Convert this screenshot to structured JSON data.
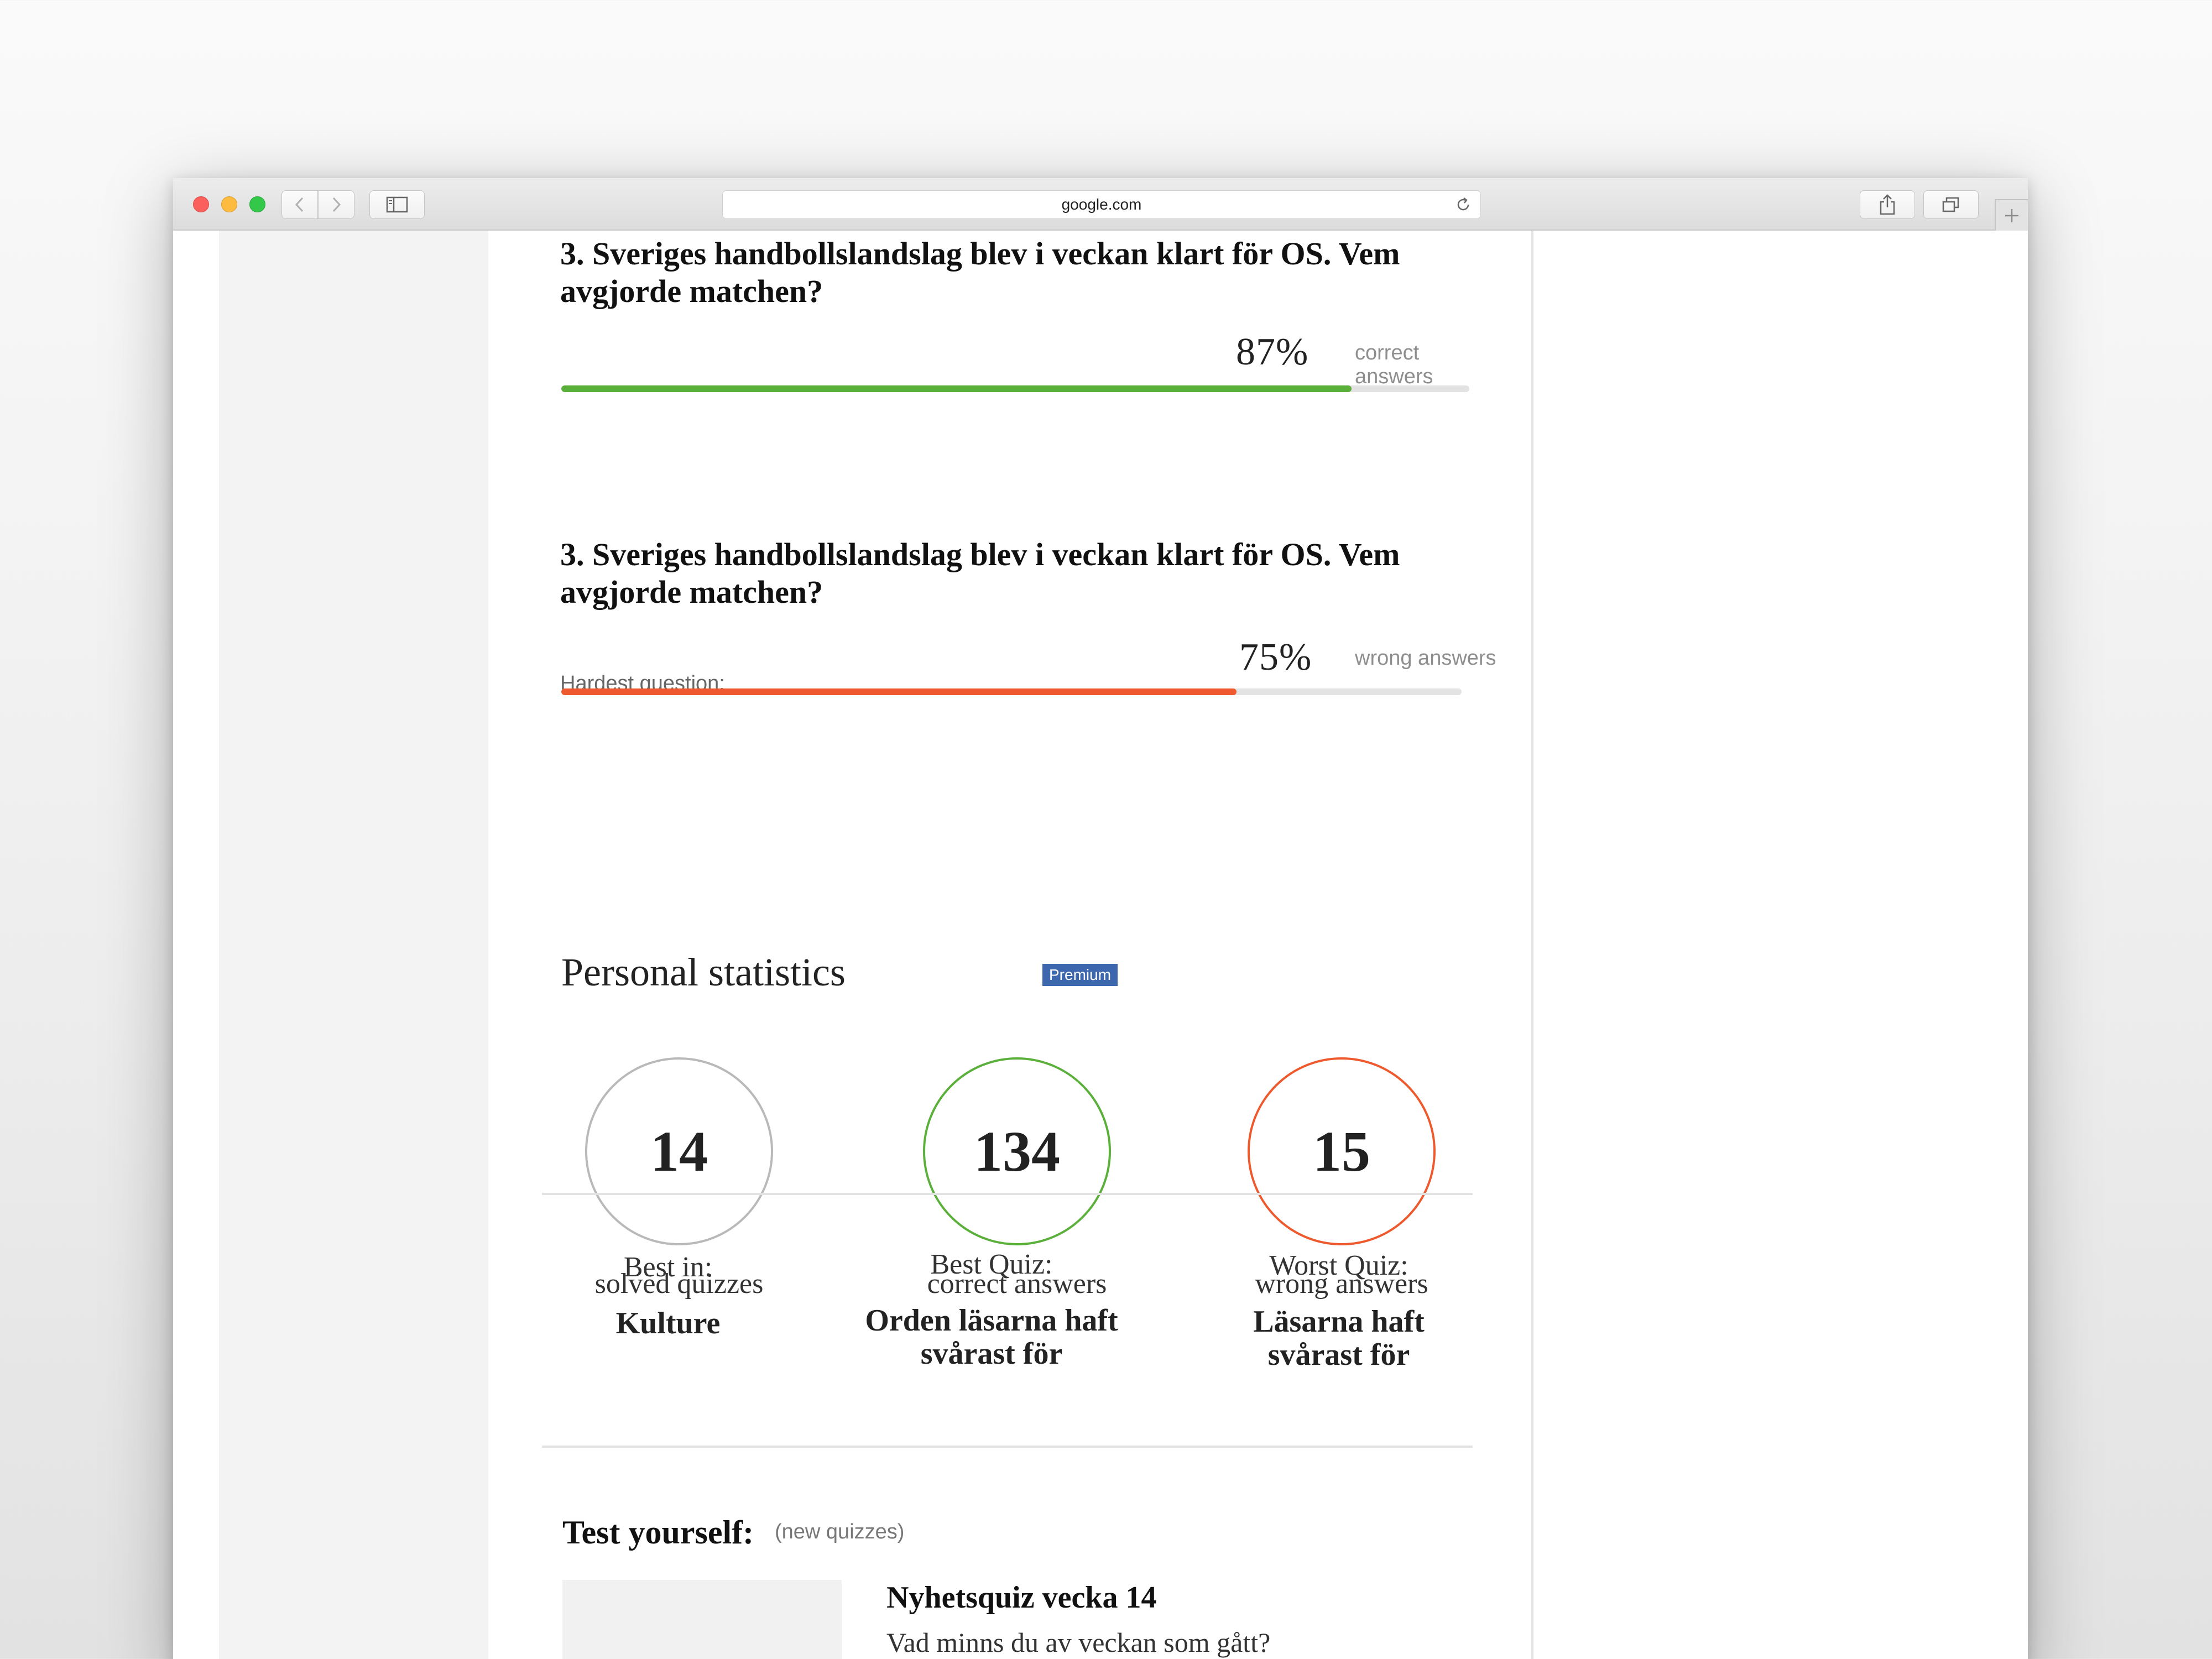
{
  "browser": {
    "url": "google.com"
  },
  "quiz_stats": {
    "easiest": {
      "question": "3. Sveriges handbollslandslag blev i veckan klart för OS. Vem avgjorde matchen?",
      "percent_text": "87%",
      "percent_value": 87,
      "label": "correct answers",
      "color": "#5bb03b"
    },
    "hardest": {
      "heading": "Hardest question:",
      "question": "3. Sveriges handbollslandslag blev i veckan klart för OS. Vem avgjorde matchen?",
      "percent_text": "75%",
      "percent_value": 75,
      "label": "wrong answers",
      "color": "#ee5a2e"
    }
  },
  "personal": {
    "title": "Personal statistics",
    "badge": "Premium",
    "stats": [
      {
        "value": "14",
        "label": "solved quizzes",
        "color": "#b9b9b9"
      },
      {
        "value": "134",
        "label": "correct answers",
        "color": "#5bb03b"
      },
      {
        "value": "15",
        "label": "wrong answers",
        "color": "#ee5a2e"
      }
    ],
    "best": [
      {
        "label": "Best in:",
        "value": "Kulture"
      },
      {
        "label": "Best Quiz:",
        "value": "Orden läsarna haft svårast för"
      },
      {
        "label": "Worst Quiz:",
        "value": "Läsarna haft svårast för"
      }
    ]
  },
  "test_yourself": {
    "title": "Test yourself:",
    "subtitle": "(new quizzes)",
    "card": {
      "title": "Nyhetsquiz vecka 14",
      "description": "Vad minns du av veckan som gått?"
    }
  },
  "colors": {
    "accent_green": "#5bb03b",
    "accent_red": "#ee5a2e",
    "premium_blue": "#3c66ad"
  }
}
